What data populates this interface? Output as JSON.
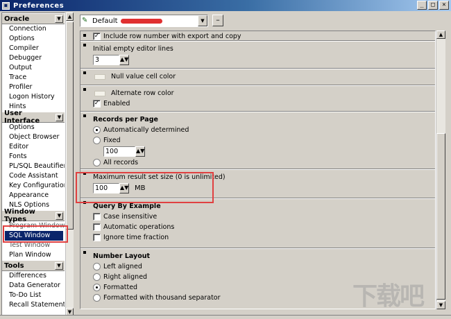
{
  "window": {
    "title": "Preferences",
    "buttons": [
      "_",
      "□",
      "✕"
    ]
  },
  "sidebar": {
    "groups": [
      {
        "header": "Oracle",
        "items": [
          "Connection",
          "Options",
          "Compiler",
          "Debugger",
          "Output",
          "Trace",
          "Profiler",
          "Logon History",
          "Hints"
        ]
      },
      {
        "header": "User Interface",
        "items": [
          "Options",
          "Object Browser",
          "Editor",
          "Fonts",
          "PL/SQL Beautifier",
          "Code Assistant",
          "Key Configuration",
          "Appearance",
          "NLS Options"
        ]
      },
      {
        "header": "Window Types",
        "items": [
          "Program Window",
          "SQL Window",
          "Test Window",
          "Plan Window"
        ],
        "selected": "SQL Window"
      },
      {
        "header": "Tools",
        "items": [
          "Differences",
          "Data Generator",
          "To-Do List",
          "Recall Statement"
        ]
      }
    ]
  },
  "toolbar": {
    "profile_value": "Default",
    "minus_label": "–"
  },
  "main": {
    "include_rownum": "Include row number with export and copy",
    "initial_lines_label": "Initial empty editor lines",
    "initial_lines_value": "3",
    "null_color_label": "Null value cell color",
    "alt_row_label": "Alternate row color",
    "enabled_label": "Enabled",
    "records_title": "Records per Page",
    "records_auto": "Automatically determined",
    "records_fixed": "Fixed",
    "records_fixed_value": "100",
    "records_all": "All records",
    "max_result_label": "Maximum result set size (0 is unlimited)",
    "max_result_value": "100",
    "max_result_unit": "MB",
    "qbe_title": "Query By Example",
    "qbe_case": "Case insensitive",
    "qbe_ops": "Automatic operations",
    "qbe_time": "Ignore time fraction",
    "num_title": "Number Layout",
    "num_left": "Left aligned",
    "num_right": "Right aligned",
    "num_formatted": "Formatted",
    "num_thousand": "Formatted with thousand separator"
  },
  "colors": {
    "highlight": "#e04040",
    "selection": "#0a246a",
    "redaction": "#e03030"
  },
  "icons": {
    "app": "app-icon",
    "profile": "profile-icon",
    "spin": "spin-icon"
  },
  "watermark": "下载吧"
}
